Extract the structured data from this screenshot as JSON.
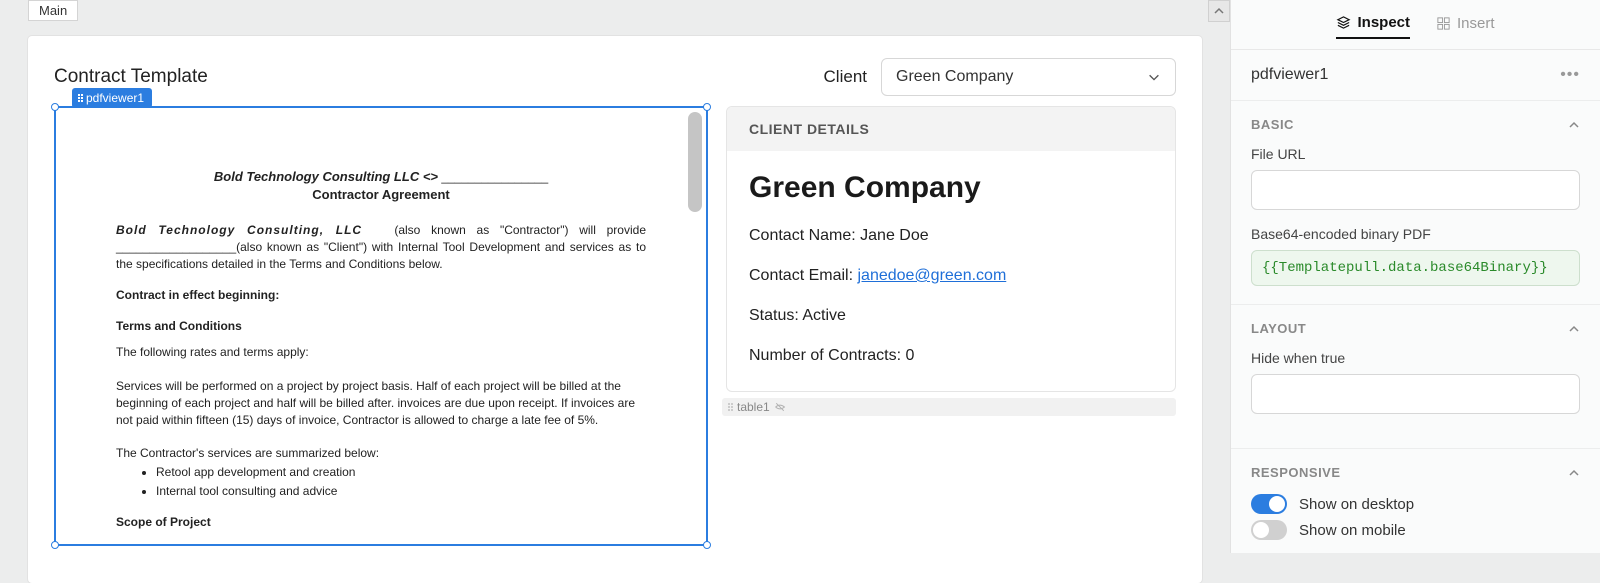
{
  "mainTab": "Main",
  "pageTitle": "Contract Template",
  "clientLabel": "Client",
  "clientSelected": "Green Company",
  "componentTag": "pdfviewer1",
  "tableTag": "table1",
  "pdf": {
    "company": "Bold Technology Consulting LLC <>",
    "heading": "Contractor Agreement",
    "para1_lead": "Bold Technology Consulting, LLC",
    "para1_rest": "(also known as \"Contractor\") will provide __________________(also known as \"Client\") with Internal Tool Development and services as to the specifications detailed in the Terms and Conditions below.",
    "effect": "Contract in effect beginning:",
    "tac": "Terms and Conditions",
    "rates": "The following rates and terms apply:",
    "services": "Services will be performed on a project by project basis. Half of each project will be billed at the beginning of each project and half will be billed after. invoices are due upon receipt. If invoices are not paid within fifteen (15) days of invoice, Contractor is allowed to charge a late fee of 5%.",
    "summary": "The Contractor's services are summarized below:",
    "bullets": [
      "Retool app development and creation",
      "Internal tool consulting and advice"
    ],
    "scope": "Scope of Project"
  },
  "details": {
    "header": "CLIENT DETAILS",
    "name": "Green Company",
    "contactNameLabel": "Contact Name: ",
    "contactName": "Jane Doe",
    "contactEmailLabel": "Contact Email: ",
    "contactEmail": "janedoe@green.com",
    "statusLabel": "Status: ",
    "status": "Active",
    "contractsLabel": "Number of Contracts: ",
    "contracts": "0"
  },
  "inspector": {
    "tabInspect": "Inspect",
    "tabInsert": "Insert",
    "componentName": "pdfviewer1",
    "basic": "BASIC",
    "fileUrl": "File URL",
    "base64Label": "Base64-encoded binary PDF",
    "base64Value": "{{Templatepull.data.base64Binary}}",
    "layout": "LAYOUT",
    "hideWhen": "Hide when true",
    "responsive": "RESPONSIVE",
    "showDesktop": "Show on desktop",
    "showMobile": "Show on mobile"
  }
}
